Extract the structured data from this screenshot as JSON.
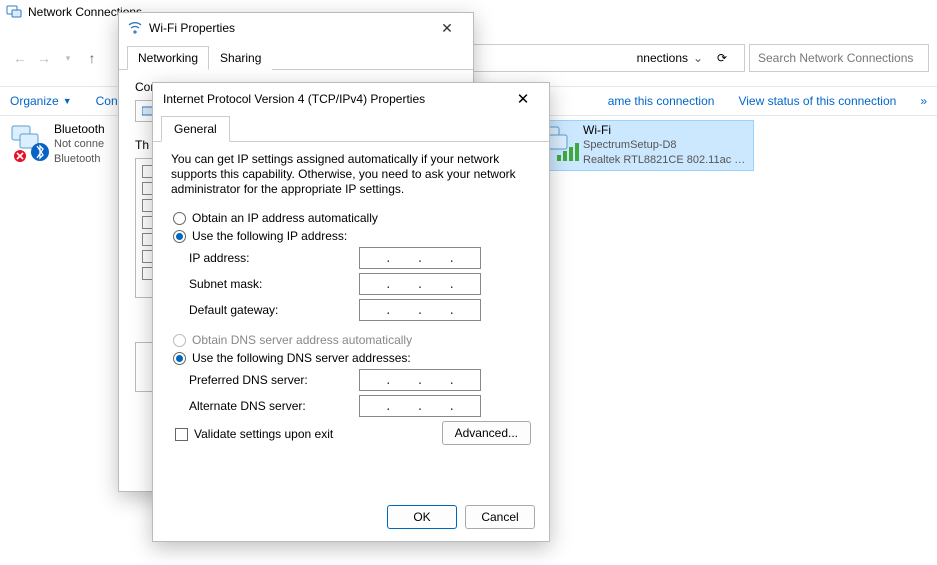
{
  "explorer": {
    "title": "Network Connections",
    "breadcrumb_visible": "nnections",
    "search_placeholder": "Search Network Connections"
  },
  "cmdbar": {
    "organize": "Organize",
    "connect_to": "Connect To",
    "rename": "ame this connection",
    "view_status": "View status of this connection"
  },
  "connections": {
    "bluetooth": {
      "name": "Bluetooth",
      "status": "Not conne",
      "device": "Bluetooth"
    },
    "wifi": {
      "name": "Wi-Fi",
      "status": "SpectrumSetup-D8",
      "device": "Realtek RTL8821CE 802.11ac PCIe ..."
    }
  },
  "wifi_dialog": {
    "title": "Wi-Fi Properties",
    "tab_networking": "Networking",
    "tab_sharing": "Sharing",
    "connect_using_label": "Connect using:",
    "this_label": "Th"
  },
  "ipv4_dialog": {
    "title": "Internet Protocol Version 4 (TCP/IPv4) Properties",
    "tab_general": "General",
    "description": "You can get IP settings assigned automatically if your network supports this capability. Otherwise, you need to ask your network administrator for the appropriate IP settings.",
    "radio_obtain_ip": "Obtain an IP address automatically",
    "radio_use_ip": "Use the following IP address:",
    "lbl_ip": "IP address:",
    "lbl_subnet": "Subnet mask:",
    "lbl_gateway": "Default gateway:",
    "radio_obtain_dns": "Obtain DNS server address automatically",
    "radio_use_dns": "Use the following DNS server addresses:",
    "lbl_pref_dns": "Preferred DNS server:",
    "lbl_alt_dns": "Alternate DNS server:",
    "chk_validate": "Validate settings upon exit",
    "btn_advanced": "Advanced...",
    "btn_ok": "OK",
    "btn_cancel": "Cancel",
    "ip_value": "",
    "subnet_value": "",
    "gateway_value": "",
    "pref_dns_value": "",
    "alt_dns_value": "",
    "obtain_ip_selected": false,
    "use_ip_selected": true,
    "obtain_dns_selected": false,
    "use_dns_selected": true,
    "validate_checked": false
  }
}
